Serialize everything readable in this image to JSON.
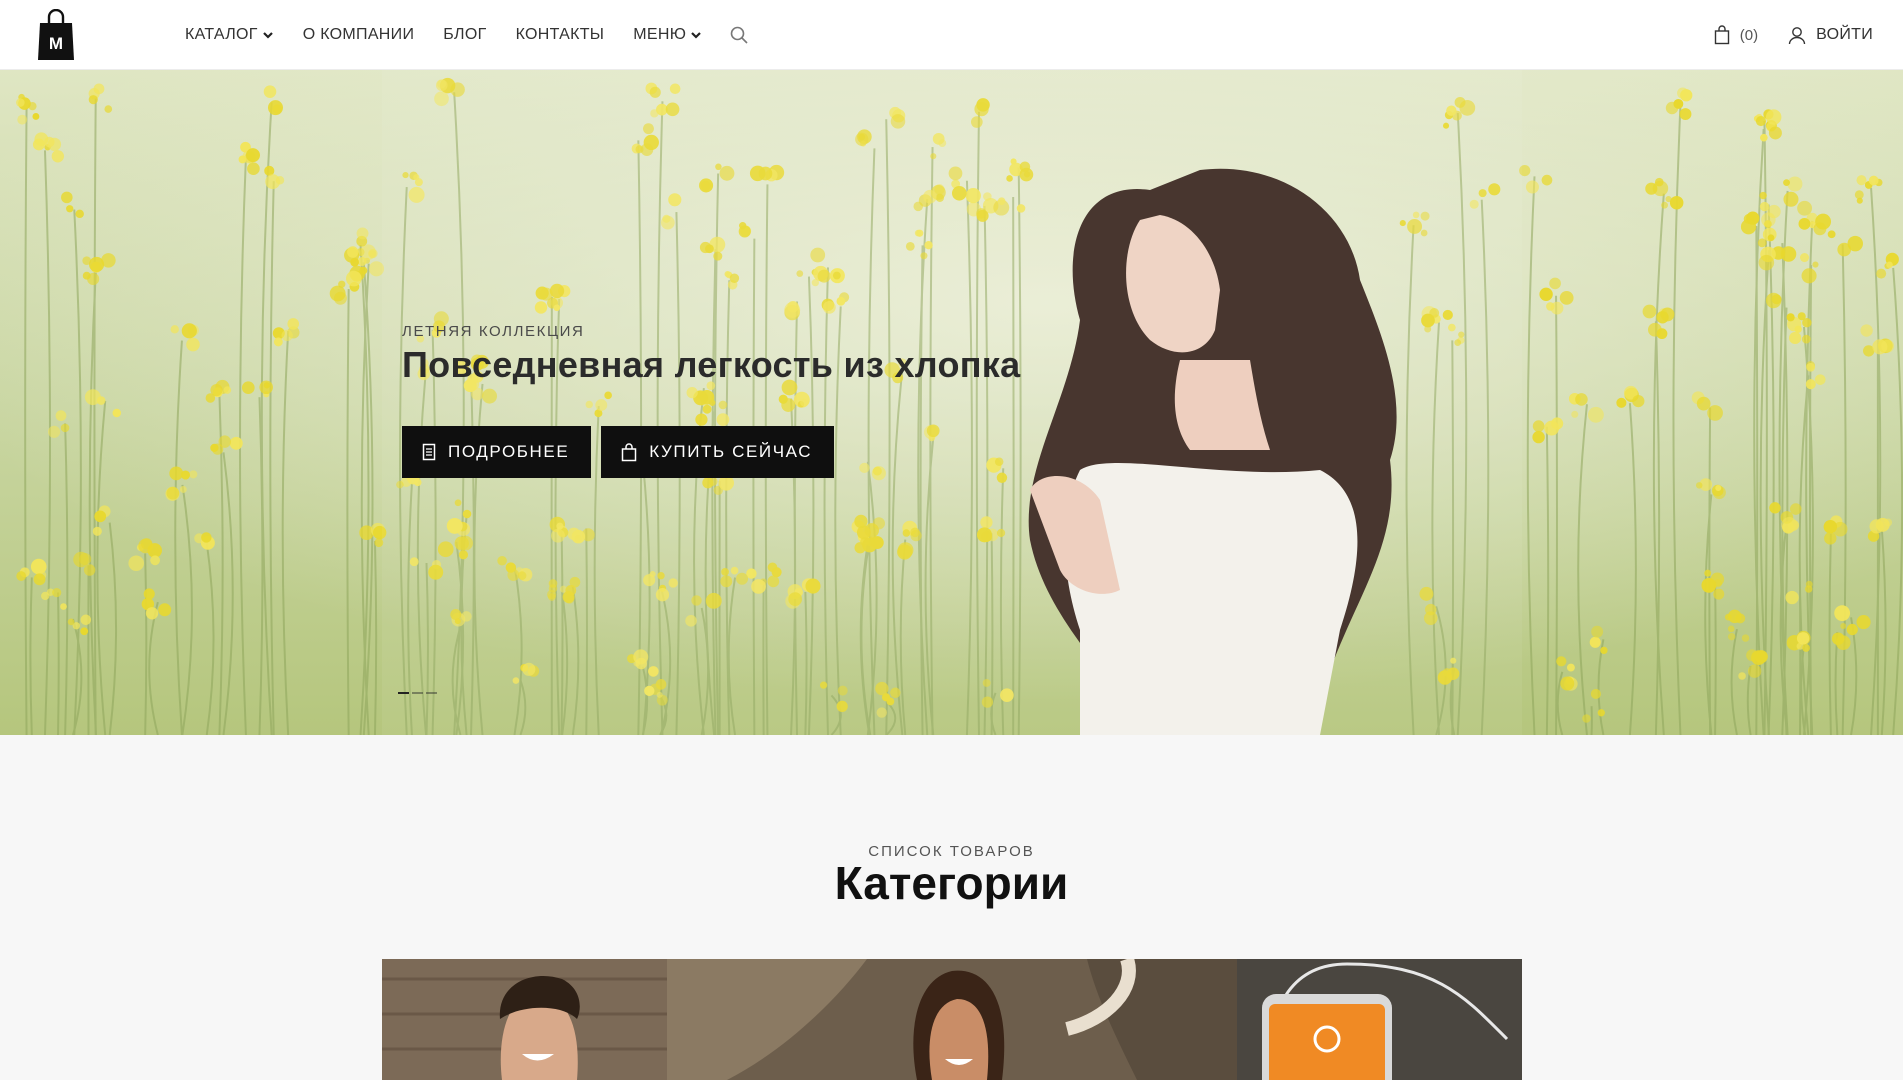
{
  "header": {
    "nav": [
      {
        "label": "Каталог",
        "has_dropdown": true
      },
      {
        "label": "О компании",
        "has_dropdown": false
      },
      {
        "label": "Блог",
        "has_dropdown": false
      },
      {
        "label": "Контакты",
        "has_dropdown": false
      },
      {
        "label": "Меню",
        "has_dropdown": true
      }
    ],
    "search_icon": "search-icon",
    "cart": {
      "icon": "shopping-bag-icon",
      "count": "(0)"
    },
    "login": {
      "icon": "user-icon",
      "label": "Войти"
    },
    "logo": {
      "icon": "shopping-bag-logo",
      "letter": "M"
    }
  },
  "hero": {
    "kicker": "Летняя коллекция",
    "title": "Повседневная легкость из хлопка",
    "buttons": [
      {
        "label": "Подробнее",
        "icon": "document-icon"
      },
      {
        "label": "Купить сейчас",
        "icon": "shopping-bag-icon"
      }
    ],
    "slides": 3,
    "active_slide": 1
  },
  "categories": {
    "kicker": "Список товаров",
    "title": "Категории"
  },
  "colors": {
    "accent": "#0f0f0f",
    "header_bg": "#ffffff",
    "page_bg": "#f7f7f7"
  }
}
